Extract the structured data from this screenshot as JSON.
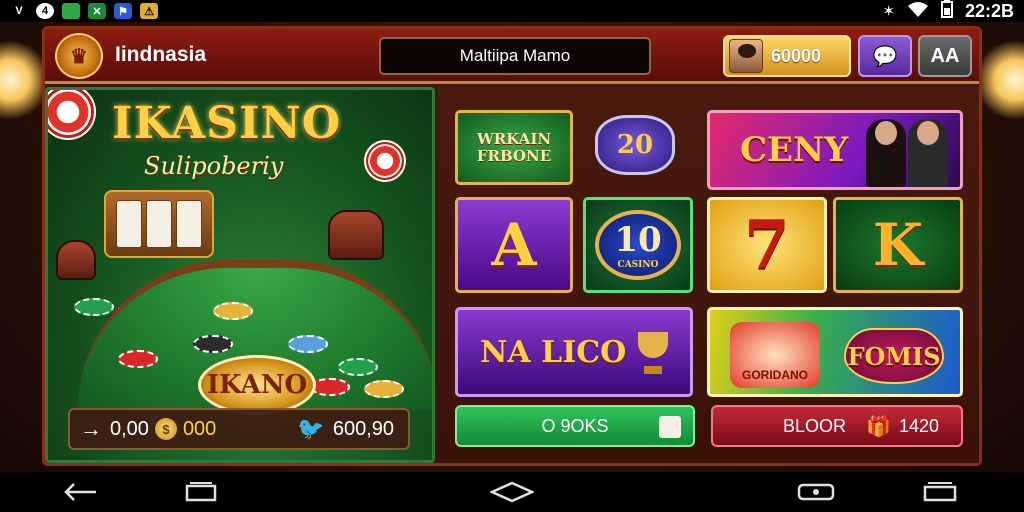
{
  "statusbar": {
    "app_icons": [
      "V",
      "4"
    ],
    "time": "22:2B"
  },
  "header": {
    "brand": "Iindnasia",
    "search_value": "Maltiipa Mamo",
    "balance": "60000",
    "lang_label": "AA"
  },
  "left_panel": {
    "title": "IKASINO",
    "subtitle": "Sulipoberiy",
    "badge": "IKANO",
    "bar": {
      "value1": "0,00",
      "value2": "000",
      "value3": "600,90"
    }
  },
  "tiles": {
    "wk_label": "WRKAIN FRBONE",
    "twenty": "20",
    "ceny": "CENY",
    "a": "A",
    "ten": "10",
    "ten_sub": "CASINO",
    "seven": "7",
    "k": "K",
    "naluco": "NA LICO",
    "cake_label": "GORIDANO",
    "fomis": "FOMIS"
  },
  "buttons": {
    "books": "O 9OKS",
    "bloor": "BLOOR",
    "bloor_value": "1420"
  },
  "colors": {
    "header_red": "#8d1c12",
    "felt_green": "#1e7a2c",
    "gold": "#ffd043",
    "button_green": "#2ec45a",
    "button_red": "#c42a3a"
  },
  "icons": [
    "wifi-icon",
    "battery-icon",
    "back-icon",
    "home-icon",
    "recents-icon",
    "chat-icon",
    "trophy-icon",
    "gift-icon"
  ]
}
